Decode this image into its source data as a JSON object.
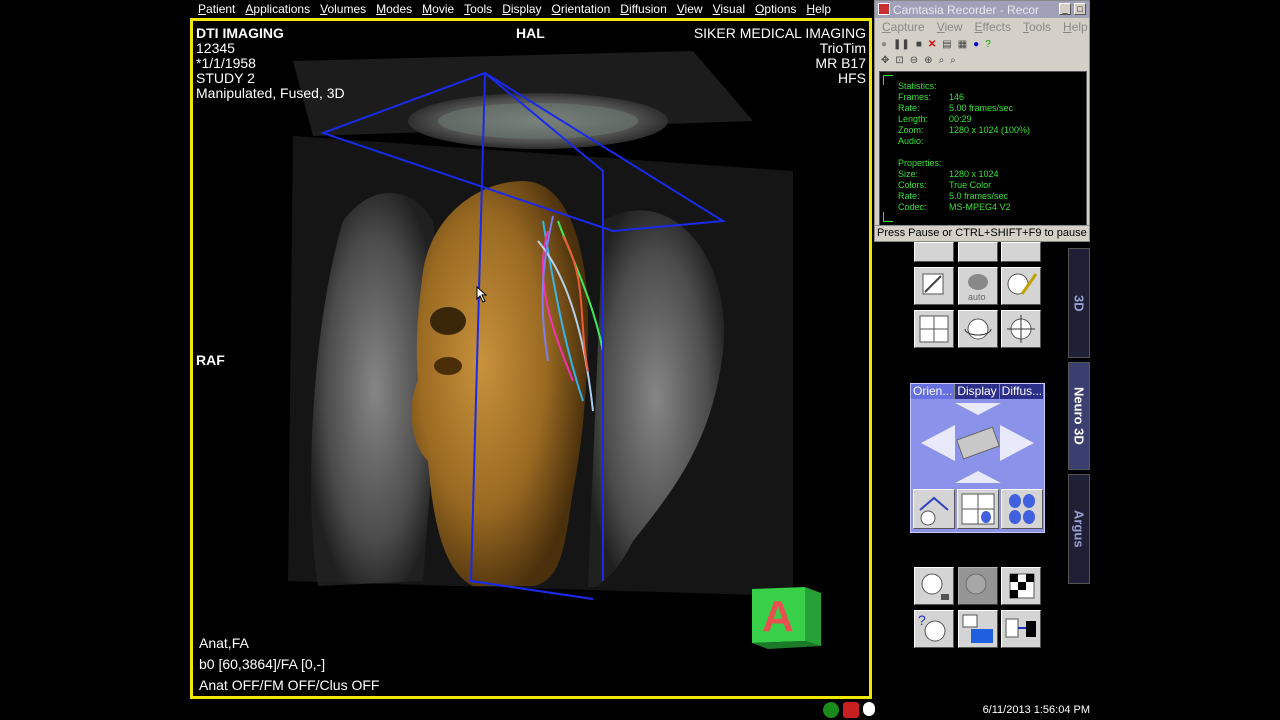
{
  "menu": [
    "Patient",
    "Applications",
    "Volumes",
    "Modes",
    "Movie",
    "Tools",
    "Display",
    "Orientation",
    "Diffusion",
    "View",
    "Visual",
    "Options",
    "Help"
  ],
  "viewer": {
    "top_left": [
      "DTI IMAGING",
      "12345",
      "*1/1/1958",
      "STUDY 2",
      "Manipulated, Fused, 3D"
    ],
    "top_center": "HAL",
    "top_right": [
      "SIKER MEDICAL IMAGING",
      "TrioTim",
      "MR B17",
      "HFS"
    ],
    "orientation_label": "RAF",
    "bottom_left": [
      "Anat,FA",
      "b0 [60,3864]/FA [0,-]",
      "Anat OFF/FM OFF/Clus OFF"
    ],
    "cube_letter": "A"
  },
  "camtasia": {
    "title": "Camtasia Recorder - Recor",
    "menu": [
      "Capture",
      "View",
      "Effects",
      "Tools",
      "Help"
    ],
    "statistics_header": "Statistics:",
    "statistics": [
      {
        "label": "Frames:",
        "value": "146"
      },
      {
        "label": "Rate:",
        "value": "5.00 frames/sec"
      },
      {
        "label": "Length:",
        "value": "00:29"
      },
      {
        "label": "Zoom:",
        "value": "1280 x 1024 (100%)"
      },
      {
        "label": "Audio:",
        "value": ""
      }
    ],
    "properties_header": "Properties:",
    "properties": [
      {
        "label": "Size:",
        "value": "1280 x 1024"
      },
      {
        "label": "Colors:",
        "value": "True Color"
      },
      {
        "label": "Rate:",
        "value": "5.0 frames/sec"
      },
      {
        "label": "Codec:",
        "value": "MS-MPEG4 V2"
      }
    ],
    "status": "Press Pause or CTRL+SHIFT+F9 to pause"
  },
  "side_tabs": [
    "3D",
    "Neuro 3D",
    "Argus"
  ],
  "orient_panel_tabs": [
    "Orien...",
    "Display",
    "Diffus..."
  ],
  "tool_auto_label": "auto",
  "datetime": "6/11/2013 1:56:04 PM"
}
